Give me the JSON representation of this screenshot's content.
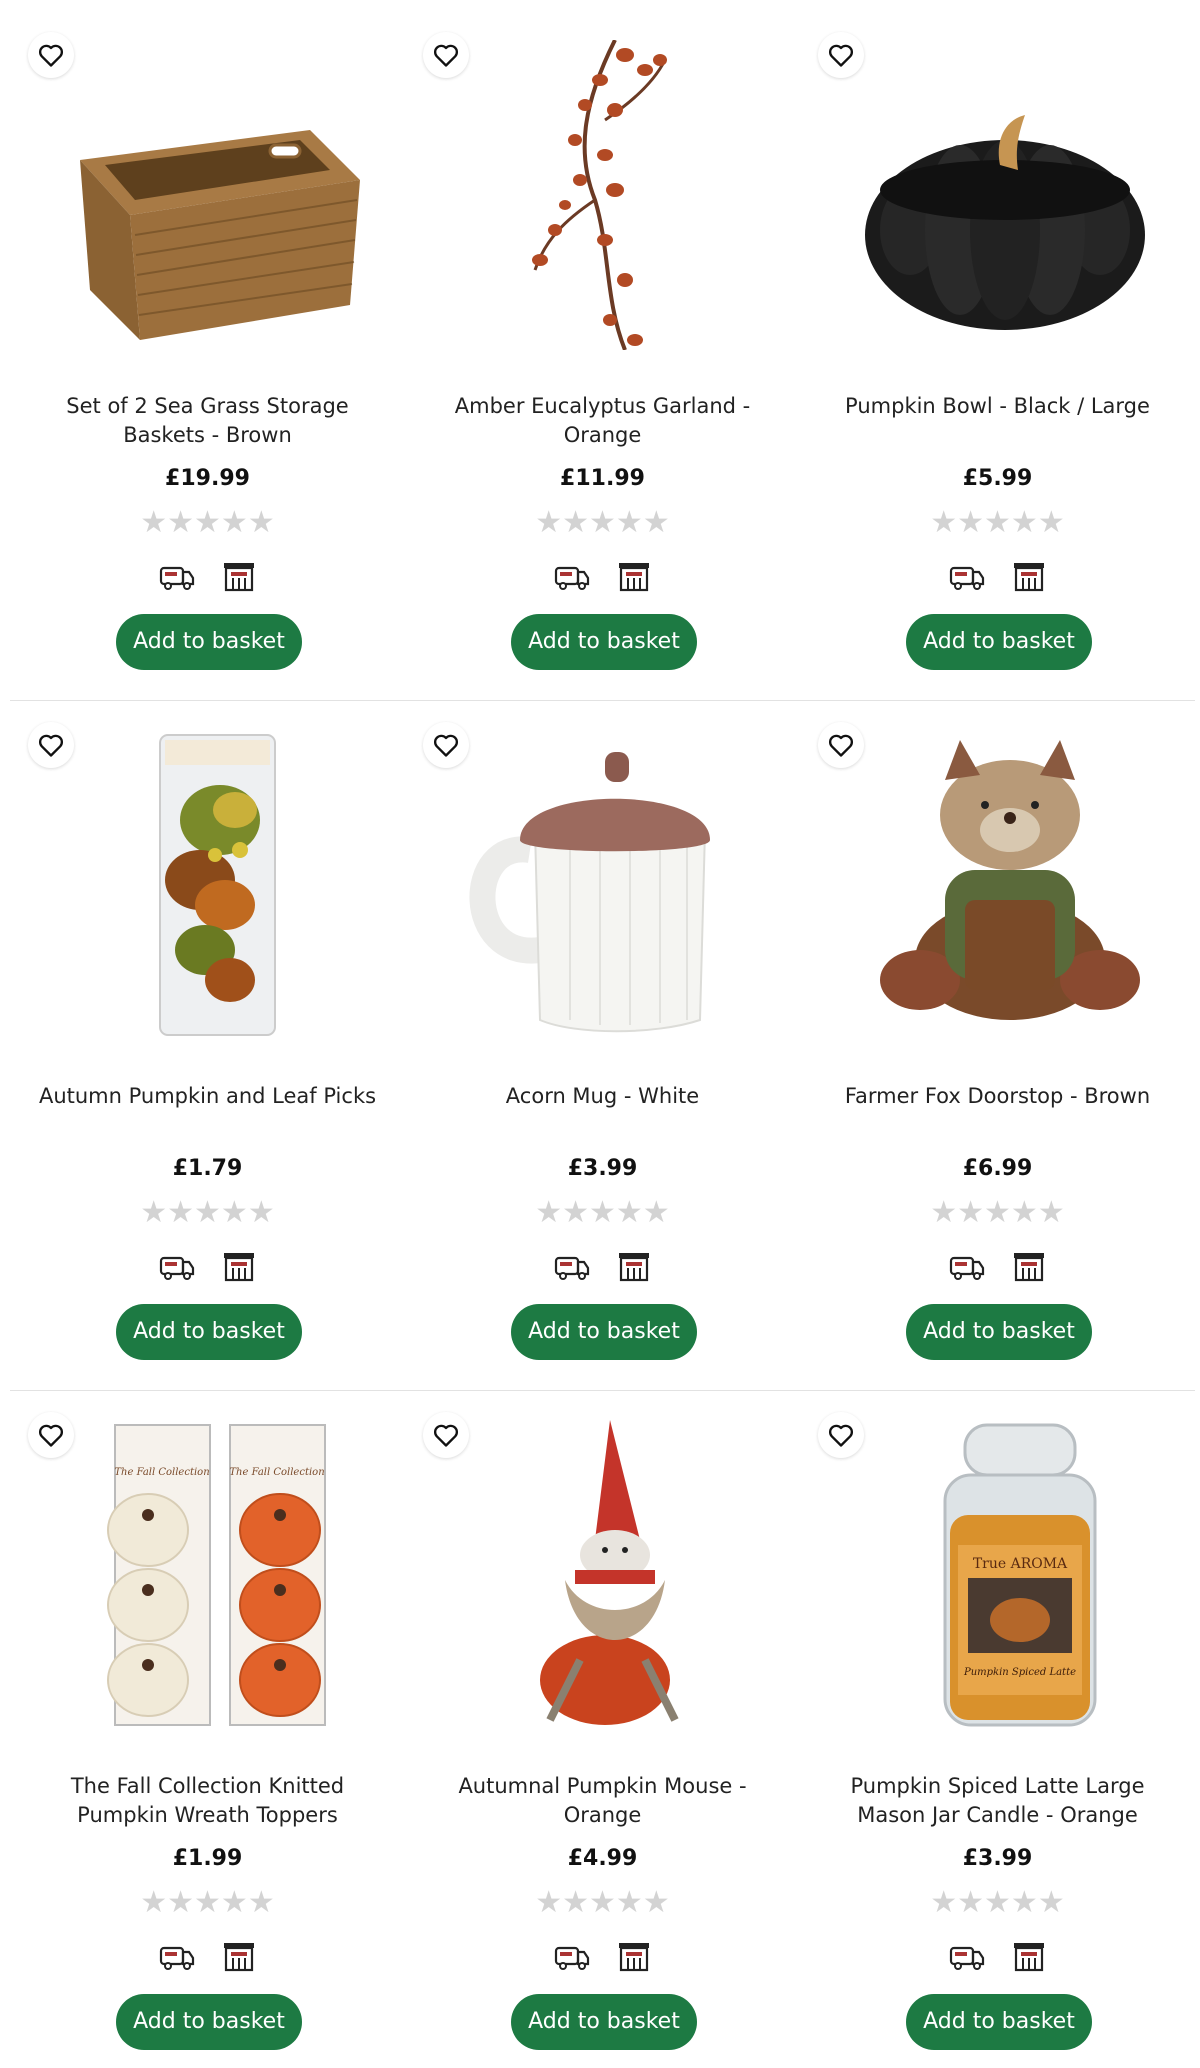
{
  "colors": {
    "button_bg": "#1d7a43",
    "button_text": "#ffffff",
    "star_empty": "#d3d3d3",
    "divider": "#e2e2e2"
  },
  "icons": {
    "wishlist": "heart-outline-icon",
    "delivery": "delivery-van-icon",
    "collect": "store-icon",
    "rating": "star-icon"
  },
  "products": [
    {
      "title": "Set of 2 Sea Grass Storage Baskets - Brown",
      "price": "£19.99",
      "stars": "★★★★★",
      "rating_out_of_5": 0,
      "button": "Add to basket"
    },
    {
      "title": "Amber Eucalyptus Garland - Orange",
      "price": "£11.99",
      "stars": "★★★★★",
      "rating_out_of_5": 0,
      "button": "Add to basket"
    },
    {
      "title": "Pumpkin Bowl - Black / Large",
      "price": "£5.99",
      "stars": "★★★★★",
      "rating_out_of_5": 0,
      "button": "Add to basket"
    },
    {
      "title": "Autumn Pumpkin and Leaf Picks",
      "price": "£1.79",
      "stars": "★★★★★",
      "rating_out_of_5": 0,
      "button": "Add to basket"
    },
    {
      "title": "Acorn Mug - White",
      "price": "£3.99",
      "stars": "★★★★★",
      "rating_out_of_5": 0,
      "button": "Add to basket"
    },
    {
      "title": "Farmer Fox Doorstop - Brown",
      "price": "£6.99",
      "stars": "★★★★★",
      "rating_out_of_5": 0,
      "button": "Add to basket"
    },
    {
      "title": "The Fall Collection Knitted Pumpkin Wreath Toppers",
      "price": "£1.99",
      "stars": "★★★★★",
      "rating_out_of_5": 0,
      "button": "Add to basket"
    },
    {
      "title": "Autumnal Pumpkin Mouse - Orange",
      "price": "£4.99",
      "stars": "★★★★★",
      "rating_out_of_5": 0,
      "button": "Add to basket"
    },
    {
      "title": "Pumpkin Spiced Latte Large Mason Jar Candle - Orange",
      "price": "£3.99",
      "stars": "★★★★★",
      "rating_out_of_5": 0,
      "button": "Add to basket"
    }
  ],
  "image_text": {
    "fall_collection_label": "The Fall Collection",
    "candle_brand": "True AROMA",
    "candle_label": "Pumpkin Spiced Latte"
  }
}
